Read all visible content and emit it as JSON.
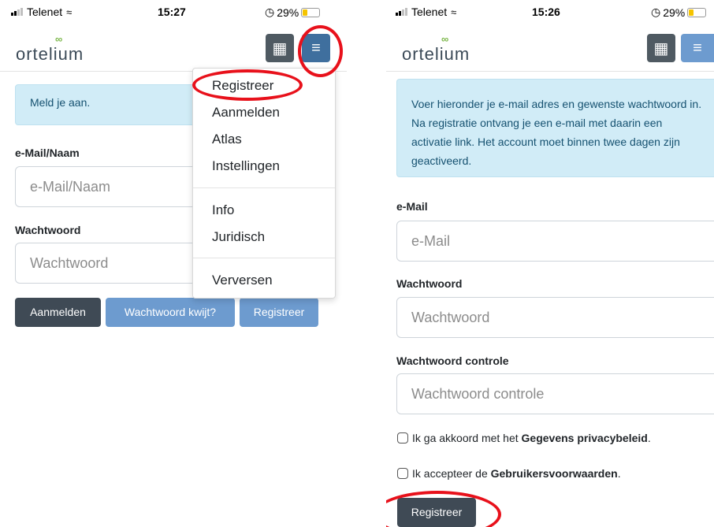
{
  "left_screen": {
    "status": {
      "carrier": "Telenet",
      "time": "15:27",
      "battery": "29%"
    },
    "brand": "ortelium",
    "alert": "Meld je aan.",
    "form": {
      "email_label": "e-Mail/Naam",
      "email_placeholder": "e-Mail/Naam",
      "password_label": "Wachtwoord",
      "password_placeholder": "Wachtwoord"
    },
    "buttons": {
      "login": "Aanmelden",
      "forgot": "Wachtwoord kwijt?",
      "register": "Registreer"
    },
    "menu": {
      "items": [
        "Registreer",
        "Aanmelden",
        "Atlas",
        "Instellingen",
        "Info",
        "Juridisch",
        "Verversen"
      ]
    }
  },
  "right_screen": {
    "status": {
      "carrier": "Telenet",
      "time": "15:26",
      "battery": "29%"
    },
    "brand": "ortelium",
    "alert": "Voer hieronder je e-mail adres en gewenste wachtwoord in. Na registratie ontvang je een e-mail met daarin een activatie link. Het account moet binnen twee dagen zijn geactiveerd.",
    "form": {
      "email_label": "e-Mail",
      "email_placeholder": "e-Mail",
      "password_label": "Wachtwoord",
      "password_placeholder": "Wachtwoord",
      "confirm_label": "Wachtwoord controle",
      "confirm_placeholder": "Wachtwoord controle"
    },
    "privacy": {
      "prefix": "Ik ga akkoord met het ",
      "link": "Gegevens privacybeleid",
      "suffix": "."
    },
    "terms": {
      "prefix": "Ik accepteer de ",
      "link": "Gebruikersvoorwaarden",
      "suffix": "."
    },
    "register_button": "Registreer"
  },
  "icons": {
    "grid": "grid-icon",
    "menu": "hamburger-icon",
    "wifi": "wifi-icon",
    "signal": "signal-icon",
    "battery": "battery-icon",
    "alarm": "alarm-icon"
  },
  "colors": {
    "brand_dark": "#3f4a55",
    "brand_blue": "#3f6f9e",
    "light_blue": "#6d9bcf",
    "alert_bg": "#d1ecf7",
    "annotation_red": "#e8111b",
    "logo_green": "#7ab648"
  }
}
